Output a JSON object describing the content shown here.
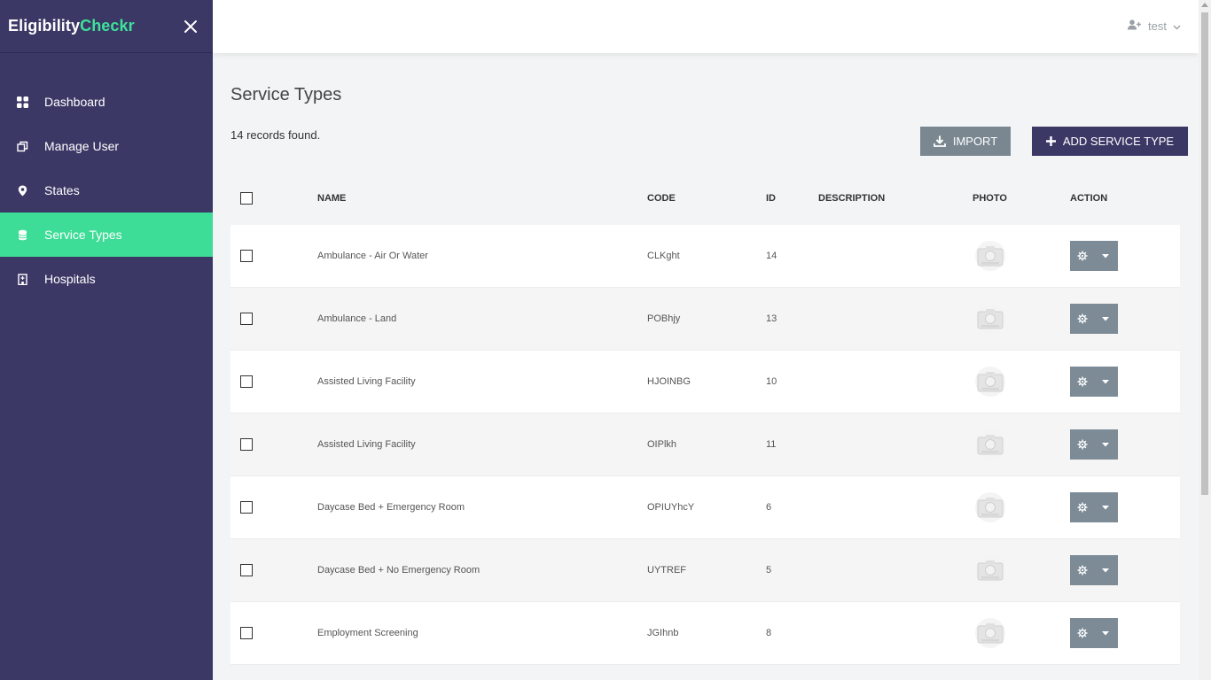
{
  "brand": {
    "part1": "Eligibility",
    "part2": "Checkr"
  },
  "sidebar": {
    "items": [
      {
        "label": "Dashboard",
        "icon": "grid-icon"
      },
      {
        "label": "Manage User",
        "icon": "copy-icon"
      },
      {
        "label": "States",
        "icon": "map-pin-icon"
      },
      {
        "label": "Service Types",
        "icon": "database-icon",
        "active": true
      },
      {
        "label": "Hospitals",
        "icon": "hospital-icon"
      }
    ]
  },
  "header": {
    "user_name": "test"
  },
  "page": {
    "title": "Service Types",
    "records_text": "14 records found.",
    "import_label": "IMPORT",
    "add_label": "ADD SERVICE TYPE"
  },
  "table": {
    "columns": {
      "name": "NAME",
      "code": "CODE",
      "id": "ID",
      "description": "DESCRIPTION",
      "photo": "PHOTO",
      "action": "ACTION"
    },
    "rows": [
      {
        "name": "Ambulance - Air Or Water",
        "code": "CLKght",
        "id": "14",
        "description": ""
      },
      {
        "name": "Ambulance - Land",
        "code": "POBhjy",
        "id": "13",
        "description": ""
      },
      {
        "name": "Assisted Living Facility",
        "code": "HJOINBG",
        "id": "10",
        "description": ""
      },
      {
        "name": "Assisted Living Facility",
        "code": "OIPlkh",
        "id": "11",
        "description": ""
      },
      {
        "name": "Daycase Bed + Emergency Room",
        "code": "OPIUYhcY",
        "id": "6",
        "description": ""
      },
      {
        "name": "Daycase Bed + No Emergency Room",
        "code": "UYTREF",
        "id": "5",
        "description": ""
      },
      {
        "name": "Employment Screening",
        "code": "JGIhnb",
        "id": "8",
        "description": ""
      }
    ]
  },
  "colors": {
    "sidebar_bg": "#3b3866",
    "accent_green": "#3ddc97",
    "import_btn": "#7a8791",
    "action_btn": "#7c8b96"
  }
}
